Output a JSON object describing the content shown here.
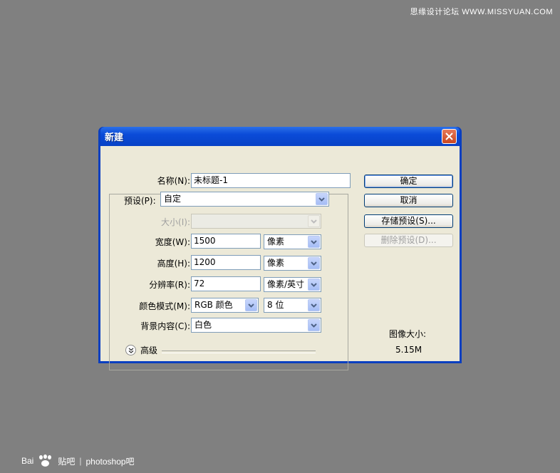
{
  "watermarks": {
    "top": "思缘设计论坛 WWW.MISSYUAN.COM",
    "bottom_brand": "Bai",
    "bottom_brand2": "贴吧",
    "bottom_separator": "|",
    "bottom_name": "photoshop吧"
  },
  "dialog": {
    "title": "新建",
    "name_label": "名称(N):",
    "name_value": "未标题-1",
    "preset_label": "预设(P):",
    "preset_value": "自定",
    "size_label": "大小(I):",
    "size_value": "",
    "width_label": "宽度(W):",
    "width_value": "1500",
    "width_unit": "像素",
    "height_label": "高度(H):",
    "height_value": "1200",
    "height_unit": "像素",
    "resolution_label": "分辨率(R):",
    "resolution_value": "72",
    "resolution_unit": "像素/英寸",
    "color_mode_label": "颜色模式(M):",
    "color_mode_value": "RGB 颜色",
    "bit_depth_value": "8 位",
    "background_label": "背景内容(C):",
    "background_value": "白色",
    "advanced_label": "高级",
    "image_size_label": "图像大小:",
    "image_size_value": "5.15M"
  },
  "buttons": {
    "ok": "确定",
    "cancel": "取消",
    "save_preset": "存储预设(S)...",
    "delete_preset": "删除预设(D)..."
  },
  "colors": {
    "desktop": "#808080",
    "titlebar": "#0a4bd8",
    "dialog_face": "#ece9d8",
    "close_button": "#c9461f"
  },
  "icons": {
    "close": "close-icon",
    "dropdown": "chevron-down-icon",
    "advanced": "double-chevron-down-icon",
    "baidu": "paw-icon"
  }
}
